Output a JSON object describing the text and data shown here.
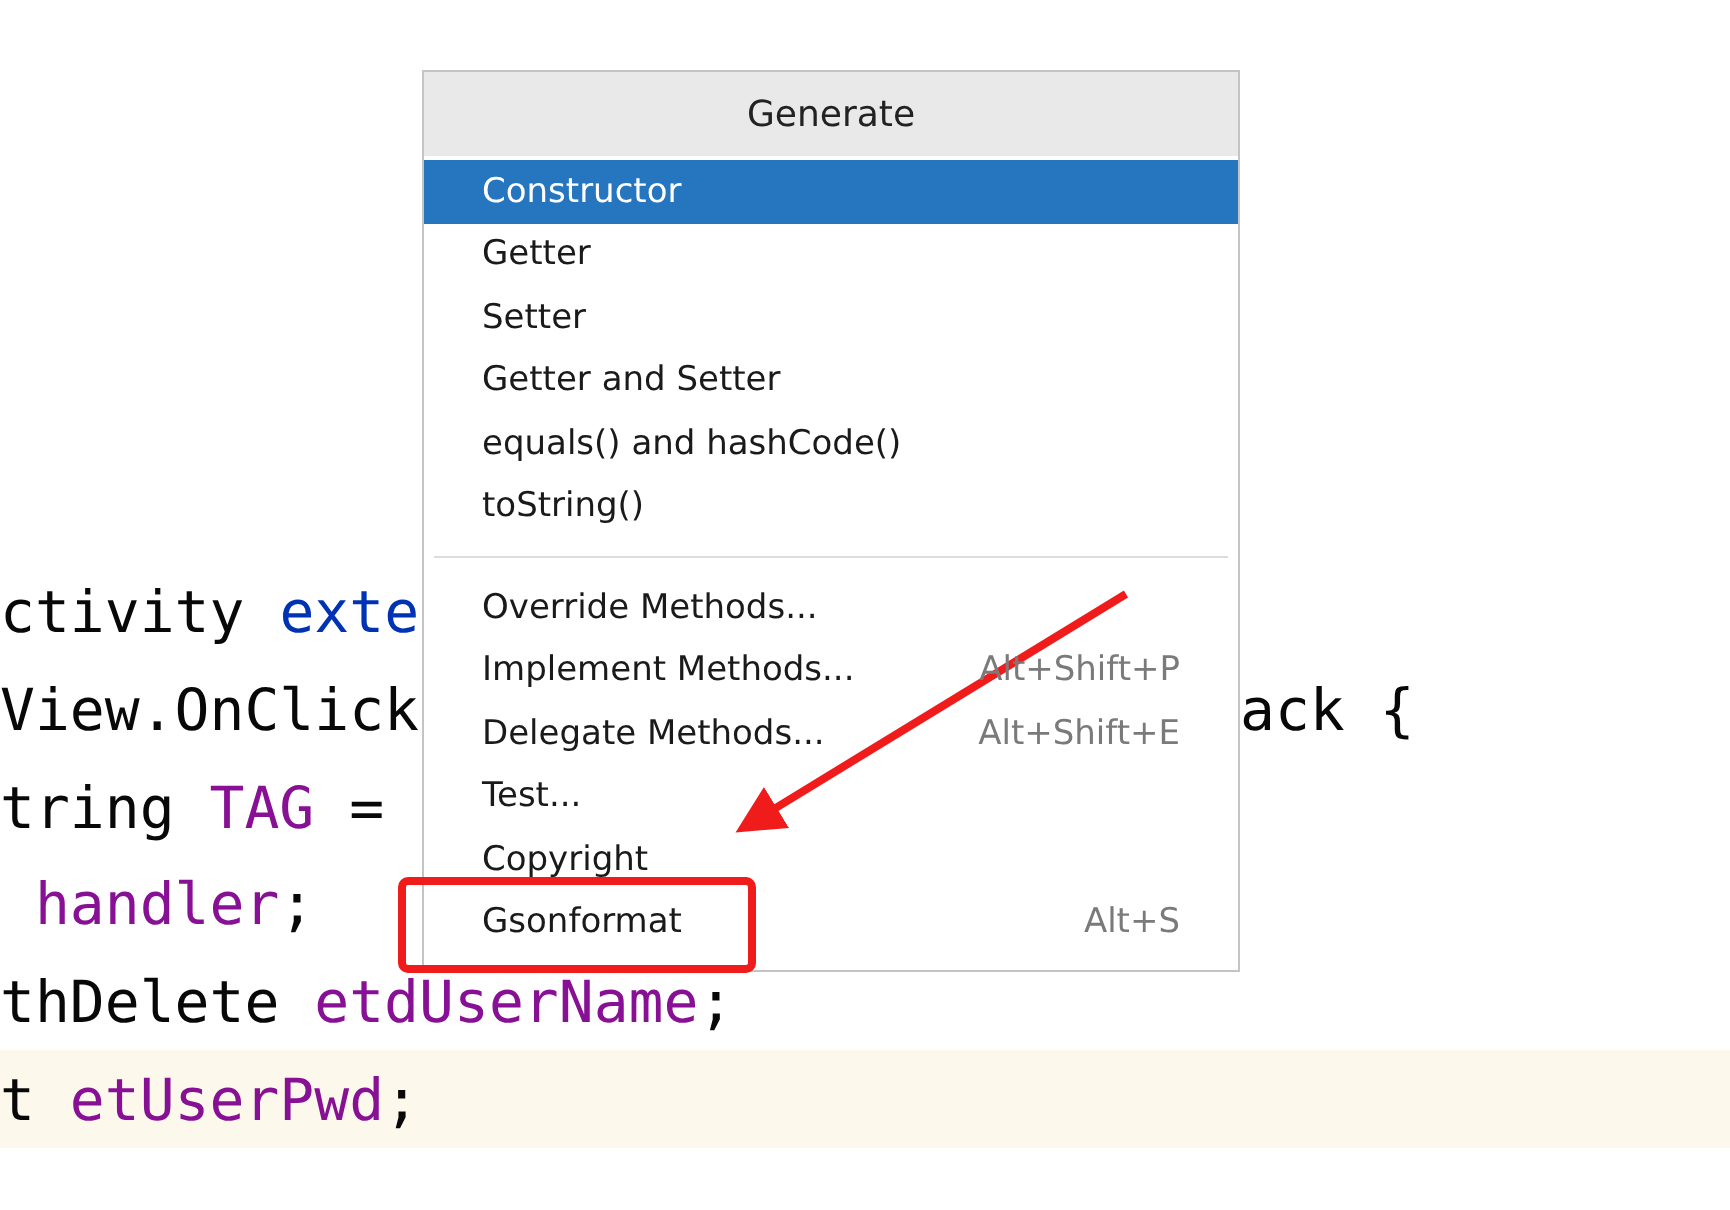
{
  "code_lines": [
    {
      "highlighted": false,
      "segments": [
        {
          "text": "ctivity ",
          "kind": "plain"
        },
        {
          "text": "exte",
          "kind": "keyword"
        }
      ]
    },
    {
      "highlighted": false,
      "segments": [
        {
          "text": "View.OnClick",
          "kind": "plain"
        }
      ],
      "trailing": "ack {"
    },
    {
      "highlighted": false,
      "segments": [
        {
          "text": "tring ",
          "kind": "plain"
        },
        {
          "text": "TAG",
          "kind": "field"
        },
        {
          "text": " =",
          "kind": "plain"
        }
      ]
    },
    {
      "highlighted": false,
      "segments": [
        {
          "text": " handler",
          "kind": "field"
        },
        {
          "text": ";",
          "kind": "plain"
        }
      ]
    },
    {
      "highlighted": false,
      "segments": [
        {
          "text": "thDelete ",
          "kind": "plain"
        },
        {
          "text": "etdUserName",
          "kind": "field"
        },
        {
          "text": ";",
          "kind": "plain"
        }
      ]
    },
    {
      "highlighted": true,
      "segments": [
        {
          "text": "t ",
          "kind": "plain"
        },
        {
          "text": "etUserPwd",
          "kind": "field"
        },
        {
          "text": ";",
          "kind": "plain"
        }
      ]
    }
  ],
  "popup": {
    "title": "Generate",
    "groups": [
      [
        {
          "label": "Constructor",
          "selected": true
        },
        {
          "label": "Getter",
          "selected": false
        },
        {
          "label": "Setter",
          "selected": false
        },
        {
          "label": "Getter and Setter",
          "selected": false
        },
        {
          "label": "equals() and hashCode()",
          "selected": false
        },
        {
          "label": "toString()",
          "selected": false
        }
      ],
      [
        {
          "label": "Override Methods...",
          "selected": false
        },
        {
          "label": "Implement Methods...",
          "shortcut": "Alt+Shift+P",
          "selected": false
        },
        {
          "label": "Delegate Methods...",
          "shortcut": "Alt+Shift+E",
          "selected": false
        },
        {
          "label": "Test...",
          "selected": false
        },
        {
          "label": "Copyright",
          "selected": false
        },
        {
          "label": "Gsonformat",
          "shortcut": "Alt+S",
          "selected": false,
          "annotated": true
        }
      ]
    ]
  }
}
